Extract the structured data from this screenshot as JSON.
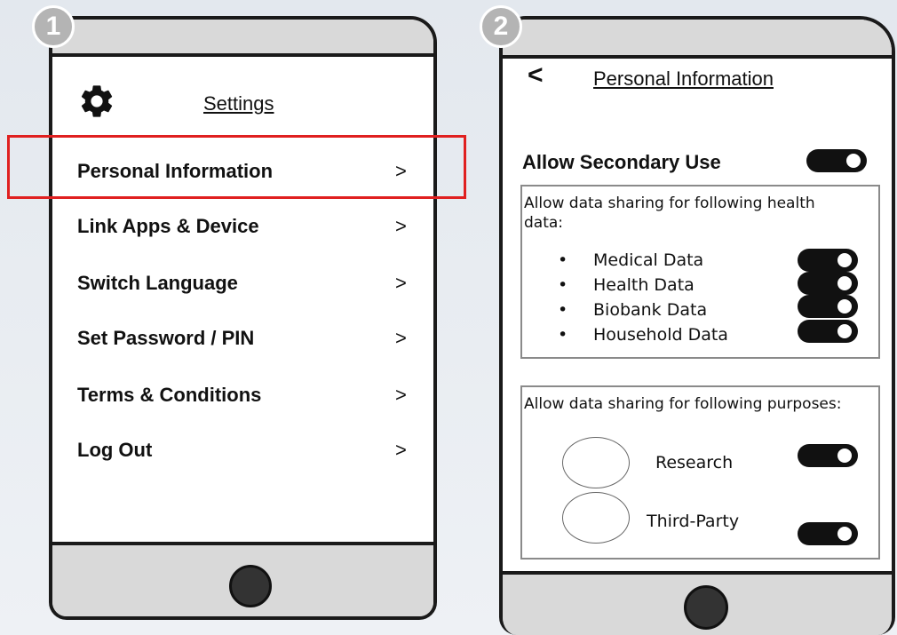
{
  "badges": [
    "1",
    "2"
  ],
  "settings_screen": {
    "title": "Settings",
    "menu": [
      {
        "label": "Personal Information",
        "chevron": ">"
      },
      {
        "label": "Link Apps & Device",
        "chevron": ">"
      },
      {
        "label": "Switch Language",
        "chevron": ">"
      },
      {
        "label": "Set Password / PIN",
        "chevron": ">"
      },
      {
        "label": "Terms & Conditions",
        "chevron": ">"
      },
      {
        "label": "Log Out",
        "chevron": ">"
      }
    ],
    "highlighted_item": "Personal Information"
  },
  "personal_info_screen": {
    "back": "<",
    "title": "Personal Information",
    "secondary_use": {
      "label": "Allow Secondary Use",
      "on": true
    },
    "health_data_panel": {
      "intro": "Allow data sharing for following health data:",
      "items": [
        {
          "label": "Medical Data",
          "on": true
        },
        {
          "label": "Health Data",
          "on": true
        },
        {
          "label": "Biobank Data",
          "on": true
        },
        {
          "label": "Household Data",
          "on": true
        }
      ],
      "bullet": "•"
    },
    "purposes_panel": {
      "intro": "Allow data sharing for following purposes:",
      "items": [
        {
          "label": "Research",
          "on": true
        },
        {
          "label": "Third-Party",
          "on": true
        }
      ]
    }
  },
  "colors": {
    "highlight": "#e02020",
    "toggle": "#111111",
    "bezel": "#d9d9d9",
    "badge": "#b4b4b4"
  }
}
